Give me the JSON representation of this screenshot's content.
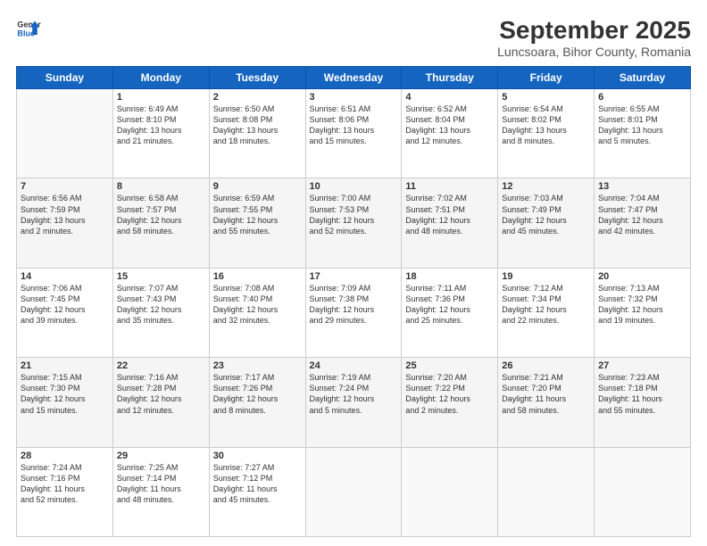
{
  "header": {
    "logo": {
      "general": "General",
      "blue": "Blue"
    },
    "title": "September 2025",
    "subtitle": "Luncsoara, Bihor County, Romania"
  },
  "days_of_week": [
    "Sunday",
    "Monday",
    "Tuesday",
    "Wednesday",
    "Thursday",
    "Friday",
    "Saturday"
  ],
  "weeks": [
    [
      {
        "day": "",
        "info": ""
      },
      {
        "day": "1",
        "info": "Sunrise: 6:49 AM\nSunset: 8:10 PM\nDaylight: 13 hours\nand 21 minutes."
      },
      {
        "day": "2",
        "info": "Sunrise: 6:50 AM\nSunset: 8:08 PM\nDaylight: 13 hours\nand 18 minutes."
      },
      {
        "day": "3",
        "info": "Sunrise: 6:51 AM\nSunset: 8:06 PM\nDaylight: 13 hours\nand 15 minutes."
      },
      {
        "day": "4",
        "info": "Sunrise: 6:52 AM\nSunset: 8:04 PM\nDaylight: 13 hours\nand 12 minutes."
      },
      {
        "day": "5",
        "info": "Sunrise: 6:54 AM\nSunset: 8:02 PM\nDaylight: 13 hours\nand 8 minutes."
      },
      {
        "day": "6",
        "info": "Sunrise: 6:55 AM\nSunset: 8:01 PM\nDaylight: 13 hours\nand 5 minutes."
      }
    ],
    [
      {
        "day": "7",
        "info": "Sunrise: 6:56 AM\nSunset: 7:59 PM\nDaylight: 13 hours\nand 2 minutes."
      },
      {
        "day": "8",
        "info": "Sunrise: 6:58 AM\nSunset: 7:57 PM\nDaylight: 12 hours\nand 58 minutes."
      },
      {
        "day": "9",
        "info": "Sunrise: 6:59 AM\nSunset: 7:55 PM\nDaylight: 12 hours\nand 55 minutes."
      },
      {
        "day": "10",
        "info": "Sunrise: 7:00 AM\nSunset: 7:53 PM\nDaylight: 12 hours\nand 52 minutes."
      },
      {
        "day": "11",
        "info": "Sunrise: 7:02 AM\nSunset: 7:51 PM\nDaylight: 12 hours\nand 48 minutes."
      },
      {
        "day": "12",
        "info": "Sunrise: 7:03 AM\nSunset: 7:49 PM\nDaylight: 12 hours\nand 45 minutes."
      },
      {
        "day": "13",
        "info": "Sunrise: 7:04 AM\nSunset: 7:47 PM\nDaylight: 12 hours\nand 42 minutes."
      }
    ],
    [
      {
        "day": "14",
        "info": "Sunrise: 7:06 AM\nSunset: 7:45 PM\nDaylight: 12 hours\nand 39 minutes."
      },
      {
        "day": "15",
        "info": "Sunrise: 7:07 AM\nSunset: 7:43 PM\nDaylight: 12 hours\nand 35 minutes."
      },
      {
        "day": "16",
        "info": "Sunrise: 7:08 AM\nSunset: 7:40 PM\nDaylight: 12 hours\nand 32 minutes."
      },
      {
        "day": "17",
        "info": "Sunrise: 7:09 AM\nSunset: 7:38 PM\nDaylight: 12 hours\nand 29 minutes."
      },
      {
        "day": "18",
        "info": "Sunrise: 7:11 AM\nSunset: 7:36 PM\nDaylight: 12 hours\nand 25 minutes."
      },
      {
        "day": "19",
        "info": "Sunrise: 7:12 AM\nSunset: 7:34 PM\nDaylight: 12 hours\nand 22 minutes."
      },
      {
        "day": "20",
        "info": "Sunrise: 7:13 AM\nSunset: 7:32 PM\nDaylight: 12 hours\nand 19 minutes."
      }
    ],
    [
      {
        "day": "21",
        "info": "Sunrise: 7:15 AM\nSunset: 7:30 PM\nDaylight: 12 hours\nand 15 minutes."
      },
      {
        "day": "22",
        "info": "Sunrise: 7:16 AM\nSunset: 7:28 PM\nDaylight: 12 hours\nand 12 minutes."
      },
      {
        "day": "23",
        "info": "Sunrise: 7:17 AM\nSunset: 7:26 PM\nDaylight: 12 hours\nand 8 minutes."
      },
      {
        "day": "24",
        "info": "Sunrise: 7:19 AM\nSunset: 7:24 PM\nDaylight: 12 hours\nand 5 minutes."
      },
      {
        "day": "25",
        "info": "Sunrise: 7:20 AM\nSunset: 7:22 PM\nDaylight: 12 hours\nand 2 minutes."
      },
      {
        "day": "26",
        "info": "Sunrise: 7:21 AM\nSunset: 7:20 PM\nDaylight: 11 hours\nand 58 minutes."
      },
      {
        "day": "27",
        "info": "Sunrise: 7:23 AM\nSunset: 7:18 PM\nDaylight: 11 hours\nand 55 minutes."
      }
    ],
    [
      {
        "day": "28",
        "info": "Sunrise: 7:24 AM\nSunset: 7:16 PM\nDaylight: 11 hours\nand 52 minutes."
      },
      {
        "day": "29",
        "info": "Sunrise: 7:25 AM\nSunset: 7:14 PM\nDaylight: 11 hours\nand 48 minutes."
      },
      {
        "day": "30",
        "info": "Sunrise: 7:27 AM\nSunset: 7:12 PM\nDaylight: 11 hours\nand 45 minutes."
      },
      {
        "day": "",
        "info": ""
      },
      {
        "day": "",
        "info": ""
      },
      {
        "day": "",
        "info": ""
      },
      {
        "day": "",
        "info": ""
      }
    ]
  ]
}
